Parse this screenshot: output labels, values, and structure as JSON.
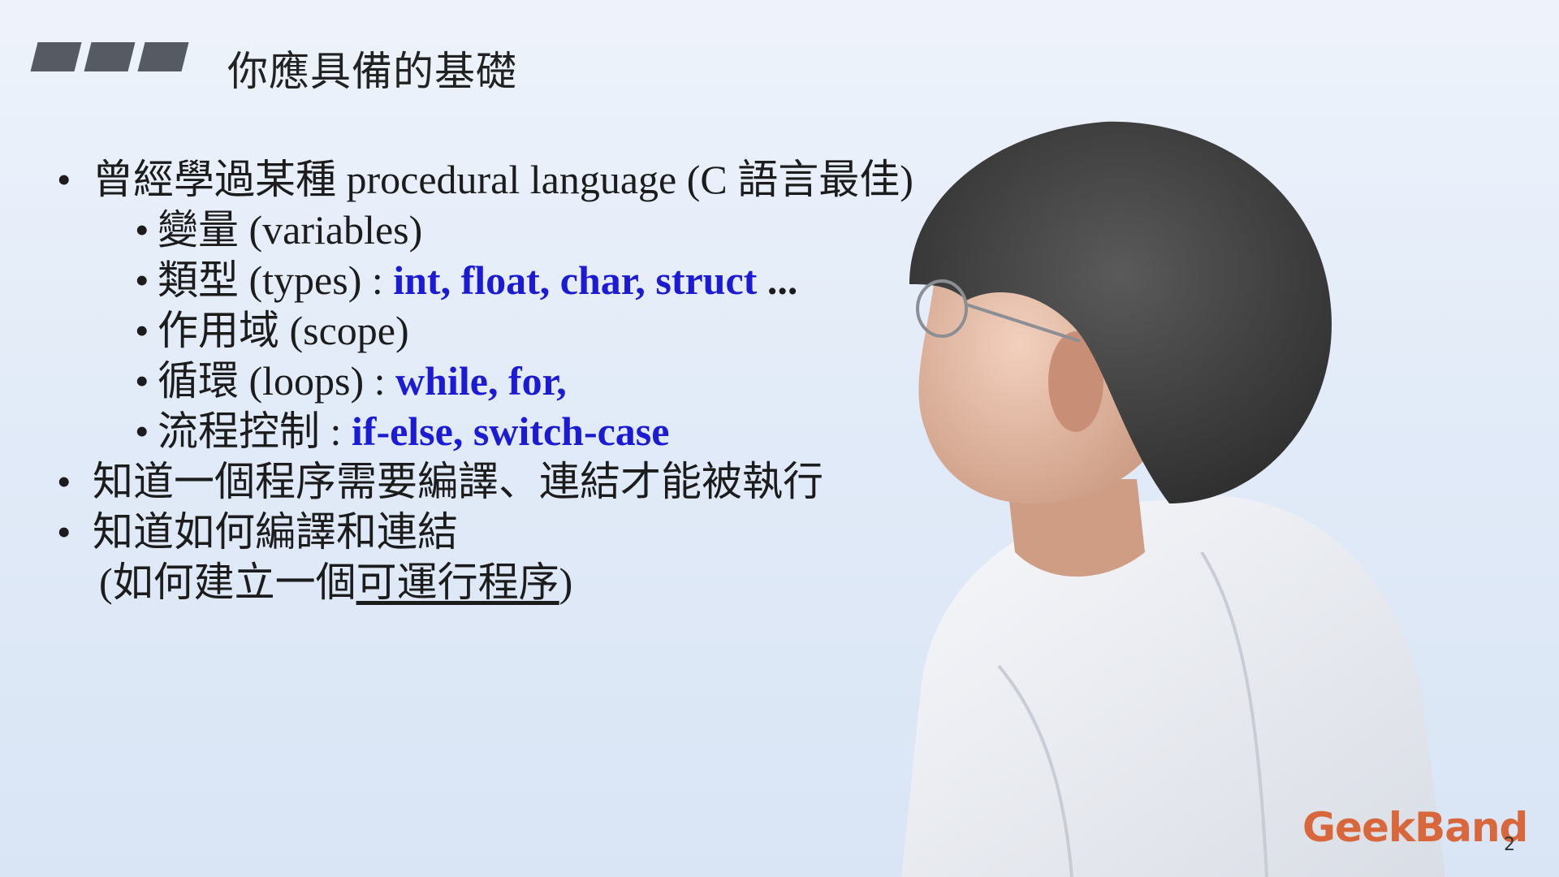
{
  "slide": {
    "title": "你應具備的基礎",
    "bullet_symbol": "•",
    "lines": [
      {
        "level": 1,
        "text": "曾經學過某種 procedural language (C 語言最佳)"
      },
      {
        "level": 2,
        "text": "變量 (variables)"
      },
      {
        "level": 2,
        "text": "類型 (types) : ",
        "keywords": "int, float, char, struct",
        "suffix": " ..."
      },
      {
        "level": 2,
        "text": "作用域 (scope)"
      },
      {
        "level": 2,
        "text": "循環 (loops) : ",
        "keywords": "while, for,"
      },
      {
        "level": 2,
        "text": "流程控制 : ",
        "keywords": "if-else, switch-case"
      },
      {
        "level": 1,
        "text": "知道一個程序需要編譯、連結才能被執行"
      },
      {
        "level": 1,
        "text": "知道如何編譯和連結"
      },
      {
        "level": 0,
        "prefix": "(如何建立一個",
        "underlined": "可運行程序",
        "suffix": ")"
      }
    ],
    "brand": "GeekBand",
    "page_number": "2"
  },
  "colors": {
    "keyword": "#1b1bd6",
    "brand": "#d8673c",
    "deco_bars": "#555a63"
  }
}
